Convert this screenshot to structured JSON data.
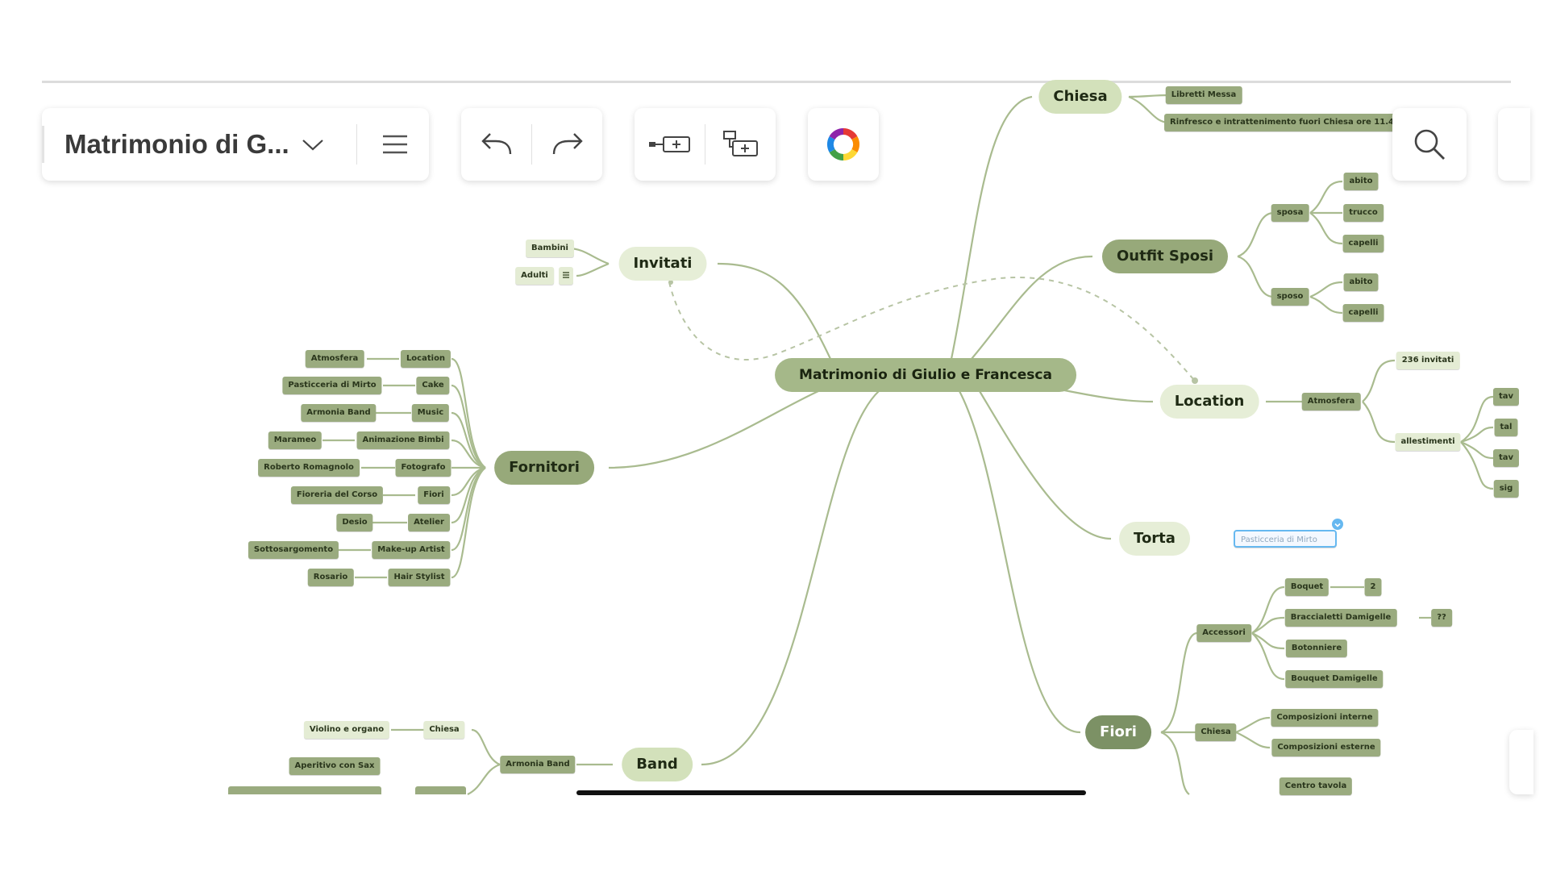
{
  "app": {
    "document_title": "Matrimonio di G...",
    "icons": {
      "title_dropdown": "chevron-down-icon",
      "menu": "hamburger-menu-icon",
      "undo": "undo-icon",
      "redo": "redo-icon",
      "add_sibling": "add-sibling-topic-icon",
      "add_child": "add-child-topic-icon",
      "theme": "color-wheel-icon",
      "search": "search-icon"
    }
  },
  "colors": {
    "dark_node": "#7c9165",
    "mid_node": "#97a97a",
    "light_node": "#d3e1bb",
    "pale_node": "#e6eed7",
    "center_node": "#a5b889",
    "branch_line": "#a9bb8f",
    "selection_accent": "#66b8f0"
  },
  "mindmap": {
    "central": "Matrimonio di Giulio e Francesca",
    "branches": {
      "chiesa": {
        "label": "Chiesa",
        "children": [
          "Libretti Messa",
          "Rinfresco e intrattenimento fuori Chiesa ore 11.4"
        ]
      },
      "outfit": {
        "label": "Outfit Sposi",
        "sposa": "sposa",
        "sposa_items": [
          "abito",
          "trucco",
          "capelli"
        ],
        "sposo": "sposo",
        "sposo_items": [
          "abito",
          "capelli"
        ]
      },
      "invitati": {
        "label": "Invitati",
        "children": [
          "Bambini",
          "Adulti"
        ]
      },
      "location": {
        "label": "Location",
        "atmosfera": "Atmosfera",
        "atmosfera_items": [
          "236 invitati",
          "allestimenti"
        ],
        "allestimenti_items": [
          "tav",
          "tal",
          "tav",
          "sig"
        ]
      },
      "fornitori": {
        "label": "Fornitori",
        "rows": [
          {
            "vendor": "Atmosfera",
            "service": "Location"
          },
          {
            "vendor": "Pasticceria di Mirto",
            "service": "Cake"
          },
          {
            "vendor": "Armonia Band",
            "service": "Music"
          },
          {
            "vendor": "Marameo",
            "service": "Animazione Bimbi"
          },
          {
            "vendor": "Roberto Romagnolo",
            "service": "Fotografo"
          },
          {
            "vendor": "Fioreria del Corso",
            "service": "Fiori"
          },
          {
            "vendor": "Desio",
            "service": "Atelier"
          },
          {
            "vendor": "Sottosargomento",
            "service": "Make-up Artist"
          },
          {
            "vendor": "Rosario",
            "service": "Hair Stylist"
          }
        ]
      },
      "torta": {
        "label": "Torta",
        "note": "Pasticceria di Mirto"
      },
      "fiori": {
        "label": "Fiori",
        "accessori": "Accessori",
        "accessori_items": [
          "Boquet",
          "Braccialetti Damigelle",
          "Botonniere",
          "Bouquet Damigelle"
        ],
        "boquet_count": "2",
        "braccialetti_count": "??",
        "chiesa": "Chiesa",
        "chiesa_items": [
          "Composizioni interne",
          "Composizioni esterne"
        ],
        "more": "Centro tavola"
      },
      "band": {
        "label": "Band",
        "armonia": "Armonia Band",
        "chiesa": "Chiesa",
        "chiesa_item": "Violino e organo",
        "aperitivo": "Aperitivo con Sax"
      }
    }
  }
}
